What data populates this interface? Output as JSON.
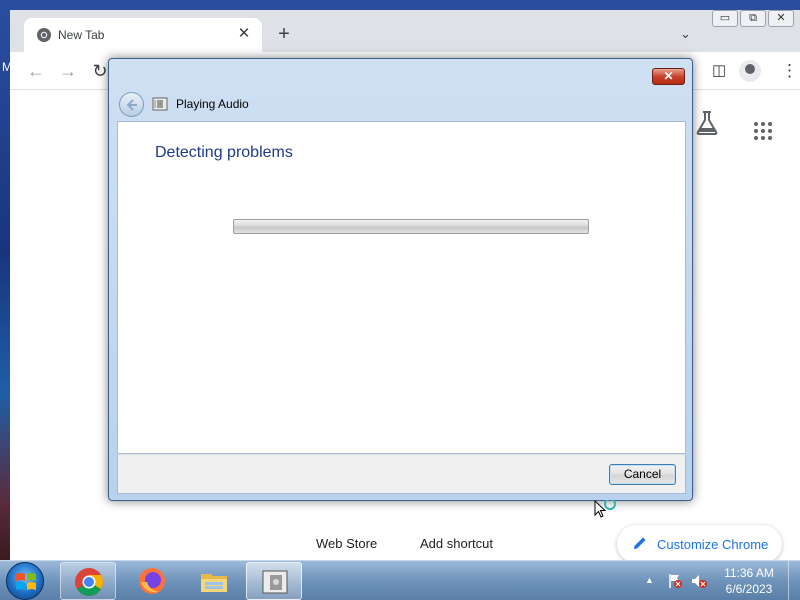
{
  "browser": {
    "tab_title": "New Tab",
    "tab_close": "✕",
    "new_tab": "+",
    "tab_search": "⌄",
    "window_buttons": [
      "▭",
      "⧉",
      "✕"
    ],
    "nav_back": "←",
    "nav_forward": "→",
    "nav_reload": "↻",
    "side_panel": "◫",
    "menu": "⋮",
    "left_edge_letter": "M"
  },
  "new_tab_page": {
    "shortcuts": [
      "Web Store",
      "Add shortcut"
    ],
    "customize_label": "Customize Chrome"
  },
  "dialog": {
    "close": "✕",
    "title": "Playing Audio",
    "heading": "Detecting problems",
    "progress_fraction": 0,
    "cancel_label": "Cancel"
  },
  "taskbar": {
    "apps": [
      "chrome-icon",
      "firefox-icon",
      "file-explorer-icon",
      "troubleshooter-icon"
    ],
    "time": "11:36 AM",
    "date": "6/6/2023"
  },
  "colors": {
    "dialog_heading": "#1e3a8a",
    "link_blue": "#1a73e8",
    "close_red": "#c8432c"
  }
}
